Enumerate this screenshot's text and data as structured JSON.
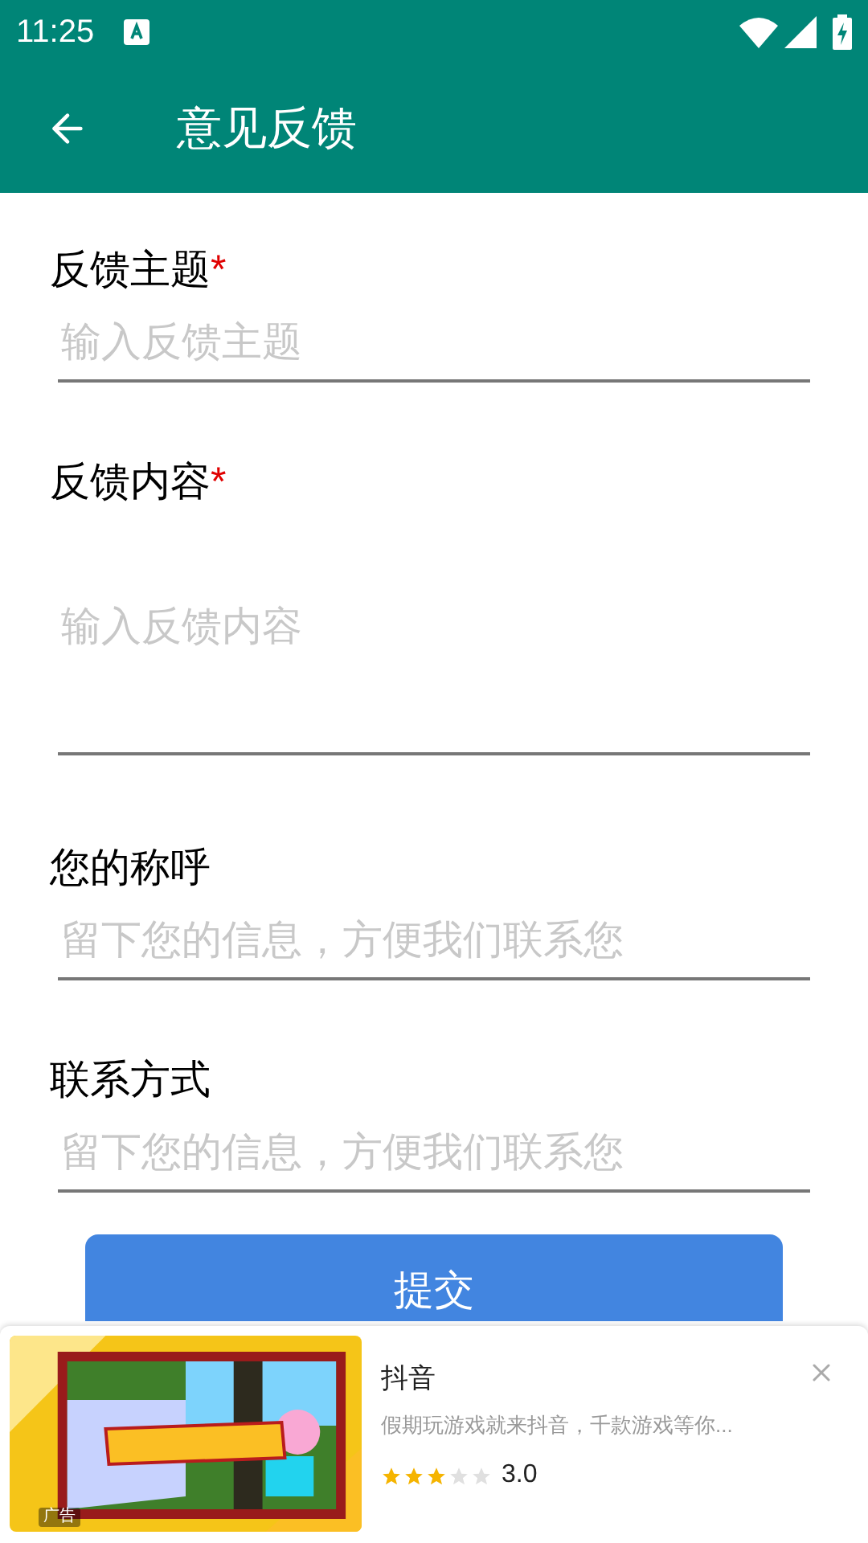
{
  "status_bar": {
    "time": "11:25"
  },
  "app_bar": {
    "title": "意见反馈"
  },
  "fields": [
    {
      "label": "反馈主题",
      "required": true,
      "placeholder": "输入反馈主题",
      "kind": "line"
    },
    {
      "label": "反馈内容",
      "required": true,
      "placeholder": "输入反馈内容",
      "kind": "multiline"
    },
    {
      "label": "您的称呼",
      "required": false,
      "placeholder": "留下您的信息，方便我们联系您",
      "kind": "line"
    },
    {
      "label": "联系方式",
      "required": false,
      "placeholder": "留下您的信息，方便我们联系您",
      "kind": "line"
    }
  ],
  "required_mark": "*",
  "submit_button": "提交",
  "ad": {
    "ad_label": "广告",
    "title": "抖音",
    "description": "假期玩游戏就来抖音，千款游戏等你...",
    "stars": 3,
    "rating": "3.0"
  }
}
